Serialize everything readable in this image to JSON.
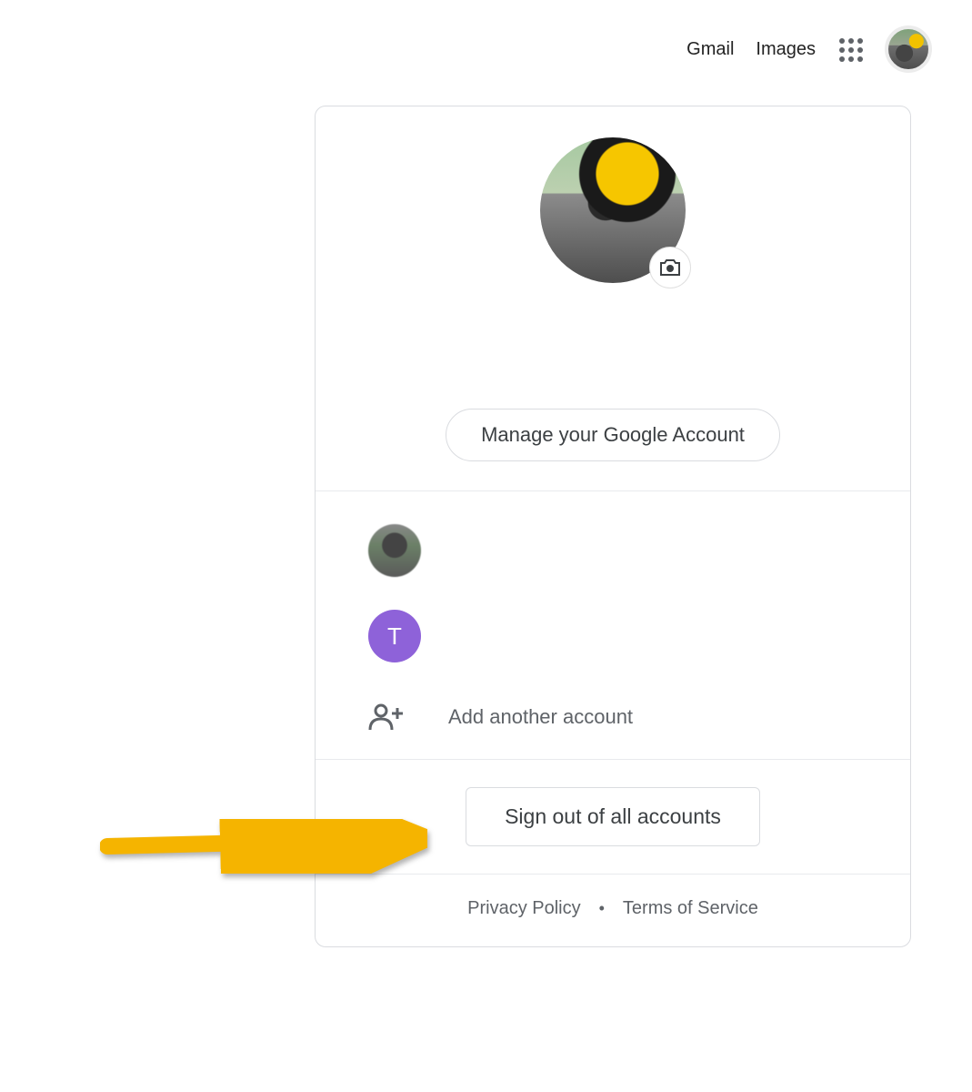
{
  "header": {
    "gmail_label": "Gmail",
    "images_label": "Images"
  },
  "popup": {
    "manage_label": "Manage your Google Account",
    "accounts": [
      {
        "kind": "photo"
      },
      {
        "kind": "letter",
        "initial": "T"
      }
    ],
    "add_label": "Add another account",
    "signout_label": "Sign out of all accounts",
    "footer": {
      "privacy_label": "Privacy Policy",
      "terms_label": "Terms of Service"
    }
  },
  "colors": {
    "arrow": "#f5b400"
  }
}
